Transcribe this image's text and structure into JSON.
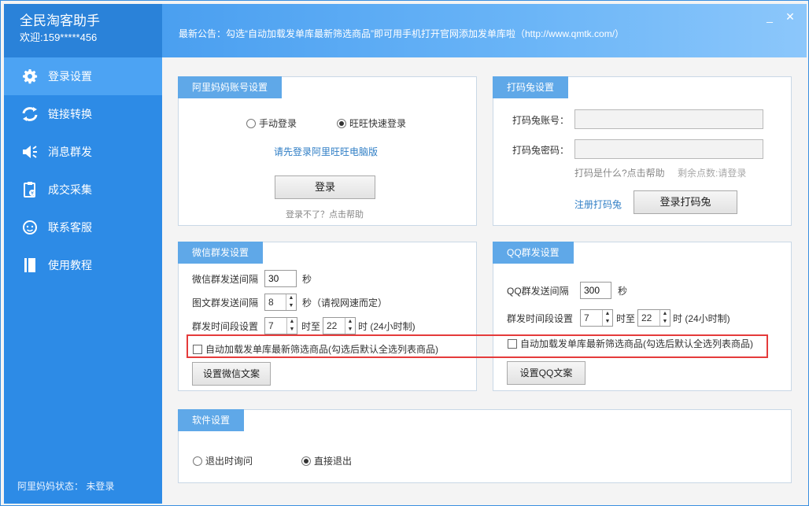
{
  "app": {
    "title": "全民淘客助手",
    "welcome": "欢迎:159*****456"
  },
  "notice": "最新公告：勾选“自动加载发单库最新筛选商品”即可用手机打开官网添加发单库啦（http://www.qmtk.com/）",
  "window_controls": {
    "minimize": "_",
    "close": "✕"
  },
  "nav": [
    {
      "label": "登录设置",
      "icon": "gear-icon"
    },
    {
      "label": "链接转换",
      "icon": "refresh-icon"
    },
    {
      "label": "消息群发",
      "icon": "speaker-icon"
    },
    {
      "label": "成交采集",
      "icon": "clipboard-icon"
    },
    {
      "label": "联系客服",
      "icon": "support-icon"
    },
    {
      "label": "使用教程",
      "icon": "book-icon"
    }
  ],
  "status": "阿里妈妈状态： 未登录",
  "alimama": {
    "tab": "阿里妈妈账号设置",
    "radio_manual": "手动登录",
    "radio_wangwang": "旺旺快速登录",
    "hint": "请先登录阿里旺旺电脑版",
    "login_button": "登录",
    "help": "登录不了？点击帮助"
  },
  "captcha": {
    "tab": "打码兔设置",
    "account_label": "打码兔账号：",
    "password_label": "打码兔密码：",
    "account_value": "",
    "password_value": "",
    "help": "打码是什么?点击帮助",
    "remaining": "剩余点数:请登录",
    "register_link": "注册打码兔",
    "login_button": "登录打码兔"
  },
  "wechat": {
    "tab": "微信群发设置",
    "interval_label": "微信群发送间隔",
    "interval_value": "30",
    "interval_unit": "秒",
    "image_interval_label": "图文群发送间隔",
    "image_interval_value": "8",
    "image_interval_unit": "秒（请视网速而定）",
    "period_label": "群发时间段设置",
    "period_from": "7",
    "period_to_label": "时至",
    "period_to": "22",
    "period_suffix": "时 (24小时制)",
    "auto_load": "自动加载发单库最新筛选商品(勾选后默认全选列表商品)",
    "set_text_button": "设置微信文案"
  },
  "qq": {
    "tab": "QQ群发设置",
    "interval_label": "QQ群发送间隔",
    "interval_value": "300",
    "interval_unit": "秒",
    "period_label": "群发时间段设置",
    "period_from": "7",
    "period_to_label": "时至",
    "period_to": "22",
    "period_suffix": "时 (24小时制)",
    "auto_load": "自动加载发单库最新筛选商品(勾选后默认全选列表商品)",
    "set_text_button": "设置QQ文案"
  },
  "software": {
    "tab": "软件设置",
    "radio_ask": "退出时询问",
    "radio_direct": "直接退出"
  }
}
